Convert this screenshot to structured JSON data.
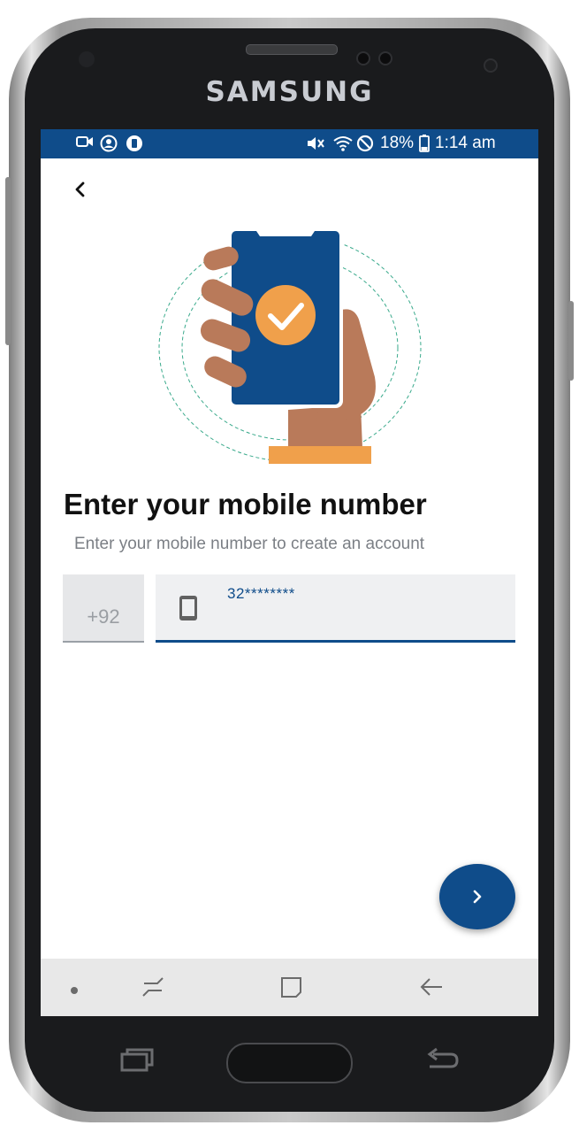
{
  "device": {
    "brand": "SAMSUNG"
  },
  "status_bar": {
    "left_icons": [
      "video-call-icon",
      "account-icon",
      "nfc-icon"
    ],
    "right_icons": [
      "mute-icon",
      "wifi-icon",
      "do-not-disturb-icon",
      "battery-icon"
    ],
    "battery": "18%",
    "time": "1:14 am"
  },
  "header": {
    "back_icon": "chevron-left-icon"
  },
  "main": {
    "illustration": "hand-phone-verified-illustration",
    "title": "Enter your mobile number",
    "subtitle": "Enter your mobile number to create an account",
    "country_code": "+92",
    "phone_input": {
      "icon": "smartphone-icon",
      "value": "32********"
    },
    "next_button_icon": "chevron-right-icon"
  },
  "nav_bar": {
    "items": [
      "dot-icon",
      "recent-apps-icon",
      "home-icon",
      "back-arrow-icon"
    ]
  },
  "colors": {
    "primary": "#0f4c8a",
    "accent": "#f0a04b",
    "skin": "#b97a5a",
    "illustration_ring": "#3aaa8c"
  }
}
